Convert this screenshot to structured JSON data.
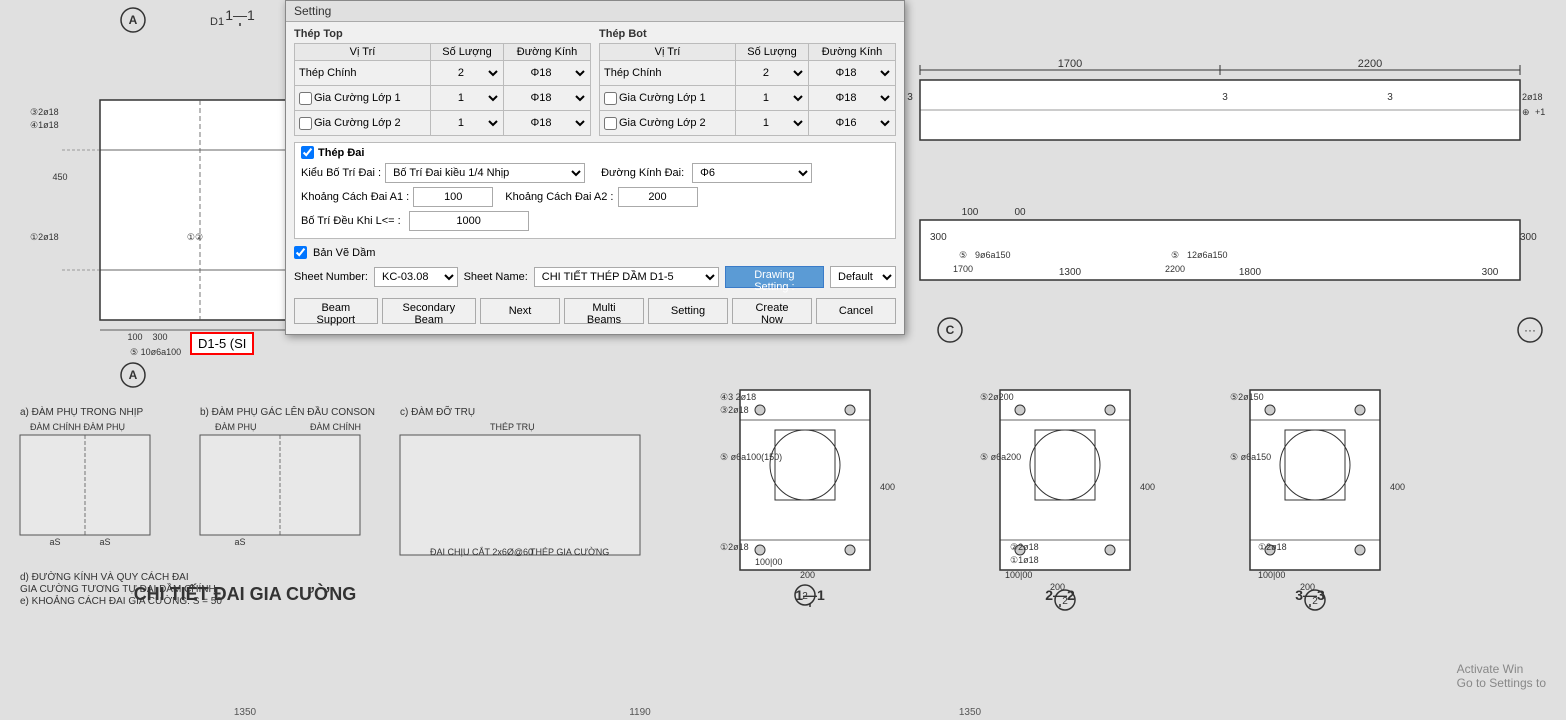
{
  "dialog": {
    "title": "Setting",
    "thep_top": {
      "label": "Thép Top",
      "columns": [
        "Vị Trí",
        "Số Lượng",
        "Đường Kính"
      ],
      "rows": [
        {
          "label": "Thép Chính",
          "checkbox": false,
          "so_luong": "2",
          "duong_kinh": "Φ18"
        },
        {
          "label": "Gia Cường Lớp 1",
          "checkbox": true,
          "checked": false,
          "so_luong": "1",
          "duong_kinh": "Φ18"
        },
        {
          "label": "Gia Cường Lớp 2",
          "checkbox": true,
          "checked": false,
          "so_luong": "1",
          "duong_kinh": "Φ18"
        }
      ]
    },
    "thep_bot": {
      "label": "Thép Bot",
      "columns": [
        "Vị Trí",
        "Số Lượng",
        "Đường Kính"
      ],
      "rows": [
        {
          "label": "Thép Chính",
          "checkbox": false,
          "so_luong": "2",
          "duong_kinh": "Φ18"
        },
        {
          "label": "Gia Cường Lớp 1",
          "checkbox": true,
          "checked": false,
          "so_luong": "1",
          "duong_kinh": "Φ18"
        },
        {
          "label": "Gia Cường Lớp 2",
          "checkbox": true,
          "checked": false,
          "so_luong": "1",
          "duong_kinh": "Φ16"
        }
      ]
    },
    "thep_dai": {
      "label": "Thép Đai",
      "checked": true,
      "kieu_bo_tri_label": "Kiểu Bố Trí Đai :",
      "kieu_bo_tri_value": "Bố Trí Đai kiều 1/4 Nhịp",
      "duong_kinh_dai_label": "Đường Kính Đai:",
      "duong_kinh_dai_value": "Φ6",
      "khoang_cach_a1_label": "Khoảng Cách Đai A1 :",
      "khoang_cach_a1_value": "100",
      "khoang_cach_a2_label": "Khoảng Cách Đai A2 :",
      "khoang_cach_a2_value": "200",
      "bo_tri_deu_label": "Bố Trí Đều Khi L<= :",
      "bo_tri_deu_value": "1000"
    },
    "ban_ve_dam": {
      "label": "Bản Vẽ Dầm",
      "checked": true
    },
    "sheet": {
      "number_label": "Sheet Number:",
      "number_value": "KC-03.08",
      "name_label": "Sheet Name:",
      "name_value": "CHI TIẾT THÉP DẦM D1-5",
      "drawing_setting_label": "Drawing Setting :",
      "default_label": "Default"
    },
    "buttons": {
      "beam_support": "Beam Support",
      "secondary_beam": "Secondary Beam",
      "next": "Next",
      "multi_beams": "Multi Beams",
      "setting": "Setting",
      "create_now": "Create Now",
      "cancel": "Cancel"
    }
  },
  "d15_label": "D1-5 (SI",
  "watermark": {
    "line1": "Activate Win",
    "line2": "Go to Settings to"
  },
  "drawing_labels": {
    "a_circle": "A",
    "c_circle": "C",
    "dim_1700": "1700",
    "dim_2200": "2200",
    "dim_300_left": "300",
    "dim_1300": "1300",
    "dim_1800": "1800",
    "dim_300_right": "300",
    "label_5_left": "5",
    "label_5_right": "5",
    "section_1_1": "1—1",
    "section_2_2": "2—2",
    "section_3_3": "3—3",
    "a_label_top": "A",
    "d1_label": "D1",
    "bottom_text_a": "a) ĐÀM PHỤ TRONG NHỊP",
    "bottom_text_b": "b) ĐÀM PHỤ GÁC LÊN ĐẦU CONSON",
    "bottom_text_c": "c) ĐÀM ĐỠ TRỤ",
    "chi_tiet_dai": "CHI TIẾT ĐAI GIA CƯỜNG",
    "note_d": "d) ĐƯỜNG KÍNH VÀ QUY CÁCH ĐAI",
    "note_e": "GIA CƯỜNG TƯƠNG TỰ ĐAI DẦM CHÍNH",
    "note_f": "e) KHOẢNG CÁCH ĐAI GIA CƯỜNG: S = 50"
  }
}
